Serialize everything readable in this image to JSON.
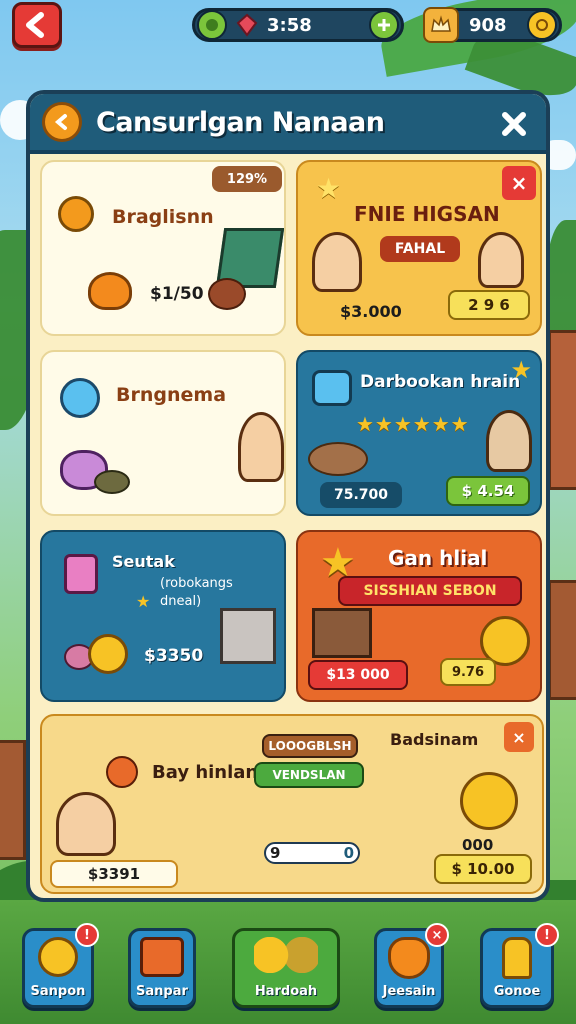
{
  "topbar": {
    "res1_value": "3:58",
    "res2_value": "908"
  },
  "panel": {
    "title": "Cansurlgan Nanaan"
  },
  "cards": {
    "c1": {
      "tag": "129%",
      "title": "Braglisnn",
      "price": "$1/50"
    },
    "c2": {
      "title": "FNIE HIGSAN",
      "subtitle": "FAHAL",
      "price": "$3.000",
      "button": "2 9 6"
    },
    "c3": {
      "title": "Brngnema"
    },
    "c4": {
      "title": "Darbookan hrain",
      "price": "75.700",
      "button": "$ 4.54"
    },
    "c5": {
      "title": "Seutak",
      "desc1": "(robokangs",
      "desc2": "dneal)",
      "price": "$3350"
    },
    "c6": {
      "title": "Gan hlial",
      "subtitle": "SISSHIAN SEBON",
      "price": "$13 000",
      "button": "9.76"
    },
    "c7": {
      "title_left": "Bay hinlan",
      "title_right": "Badsinam",
      "banner_top": "LOOOGBLSH",
      "banner_bottom": "VENDSLAN",
      "price": "$3391",
      "slider_left": "9",
      "slider_right": "0",
      "coins": "000",
      "button": "$ 10.00"
    }
  },
  "nav": [
    {
      "label": "Sanpon",
      "badge": "!"
    },
    {
      "label": "Sanpar",
      "badge": ""
    },
    {
      "label": "Hardoah",
      "badge": ""
    },
    {
      "label": "Jeesain",
      "badge": "×"
    },
    {
      "label": "Gonoe",
      "badge": "!"
    }
  ],
  "colors": {
    "panel_header": "#1f5c7a",
    "cream": "#fbefc4",
    "orange": "#f3b23c",
    "teal": "#27779e",
    "red_orange": "#e86a2a",
    "green_button": "#7bc53b"
  }
}
